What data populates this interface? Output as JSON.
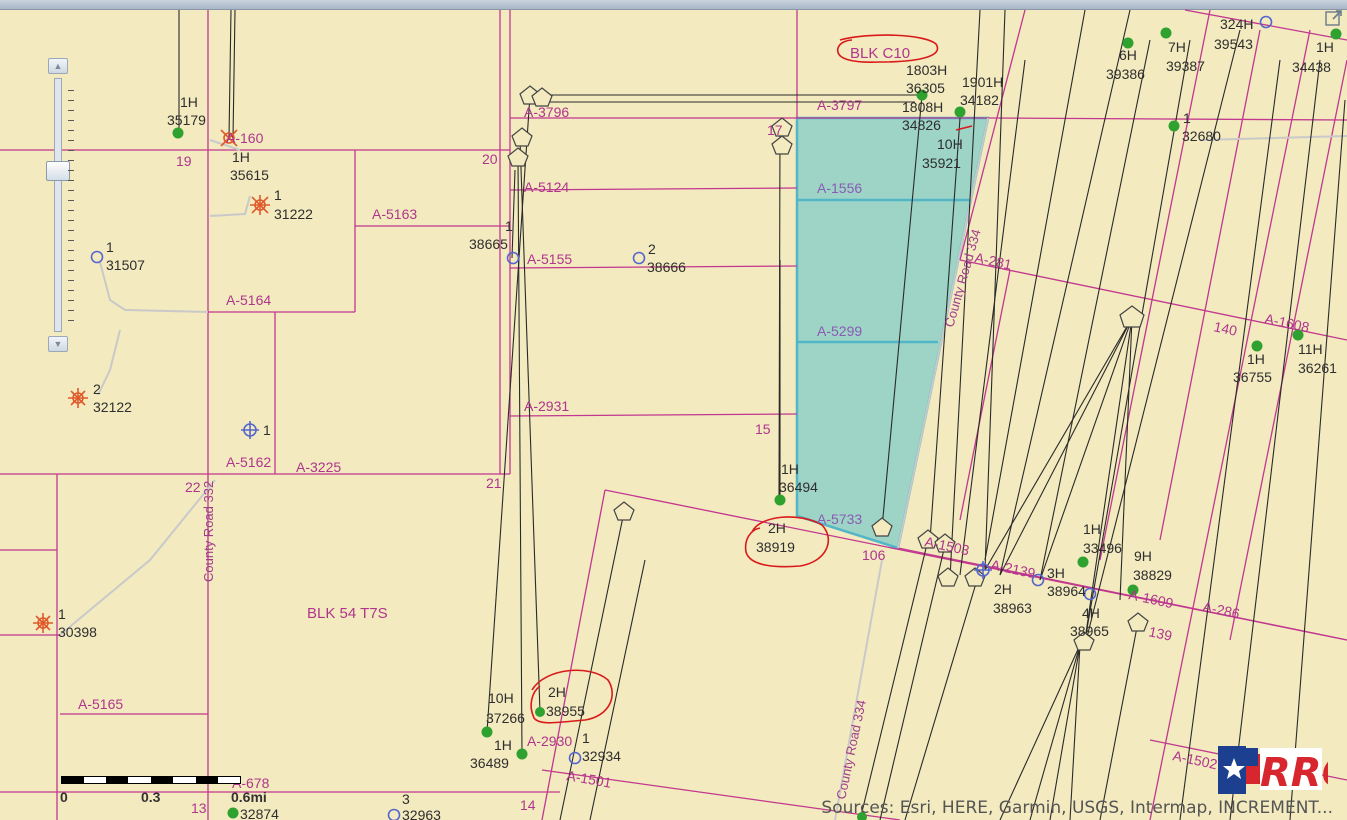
{
  "map": {
    "blocks": [
      "BLK C10",
      "BLK 54 T7S"
    ],
    "sections": [
      "19",
      "20",
      "17",
      "15",
      "22",
      "21",
      "106",
      "13",
      "14",
      "140",
      "139"
    ],
    "abstracts": [
      "A-3797",
      "A-3796",
      "A-5124",
      "A-1556",
      "A-5163",
      "A-5155",
      "A-5164",
      "A-5299",
      "A-2931",
      "A-5162",
      "A-3225",
      "A-5733",
      "A-5165",
      "A-2930",
      "A-1501",
      "A-678",
      "A-281",
      "A-1608",
      "A-2139",
      "A-1609",
      "A-286",
      "A-1503",
      "A-1502",
      "A-160"
    ],
    "roads": [
      "County Road 332",
      "County Road 334",
      "County Road 334"
    ],
    "wells": [
      {
        "num": "1H",
        "id": "35179"
      },
      {
        "num": "1H",
        "id": "35615"
      },
      {
        "num": "1",
        "id": "31222"
      },
      {
        "num": "1",
        "id": "31507"
      },
      {
        "num": "2",
        "id": "32122"
      },
      {
        "num": "1",
        "id": ""
      },
      {
        "num": "1",
        "id": "30398"
      },
      {
        "num": "1",
        "id": "38665"
      },
      {
        "num": "2",
        "id": "38666"
      },
      {
        "num": "1H",
        "id": "36494"
      },
      {
        "num": "2H",
        "id": "38919"
      },
      {
        "num": "2H",
        "id": "38955"
      },
      {
        "num": "10H",
        "id": "37266"
      },
      {
        "num": "1H",
        "id": "36489"
      },
      {
        "num": "1",
        "id": "32934"
      },
      {
        "num": "3",
        "id": "32963"
      },
      {
        "num": "",
        "id": "32874"
      },
      {
        "num": "1803H",
        "id": "36305"
      },
      {
        "num": "1901H",
        "id": "34182"
      },
      {
        "num": "1808H",
        "id": "34826"
      },
      {
        "num": "10H",
        "id": "35921"
      },
      {
        "num": "6H",
        "id": "39386"
      },
      {
        "num": "7H",
        "id": "39387"
      },
      {
        "num": "324H",
        "id": "39543"
      },
      {
        "num": "1H",
        "id": "34438"
      },
      {
        "num": "1",
        "id": "32680"
      },
      {
        "num": "1H",
        "id": "36755"
      },
      {
        "num": "11H",
        "id": "36261"
      },
      {
        "num": "1H",
        "id": "33496"
      },
      {
        "num": "9H",
        "id": "38829"
      },
      {
        "num": "3H",
        "id": "38964"
      },
      {
        "num": "2H",
        "id": "38963"
      },
      {
        "num": "4H",
        "id": "38965"
      }
    ]
  },
  "scale": {
    "labels": [
      "0",
      "0.3",
      "0.6mi"
    ]
  },
  "attribution": "Sources: Esri, HERE, Garmin, USGS, Intermap, INCREMENT...",
  "logo": {
    "text": "RRC",
    "colors": {
      "red": "#d8262f",
      "blue": "#1d3f8f"
    }
  },
  "colors": {
    "map_bg": "#f3eabf",
    "lease_line": "#c2378f",
    "highlight": "#6fc7c7",
    "well_green": "#2fa12f",
    "well_blue": "#5566cc",
    "well_orange": "#e05a2b",
    "annotation_red": "#d91a1a"
  },
  "icons": {
    "zoom_in": "▲",
    "zoom_out": "▼",
    "expand": "expand-icon"
  }
}
